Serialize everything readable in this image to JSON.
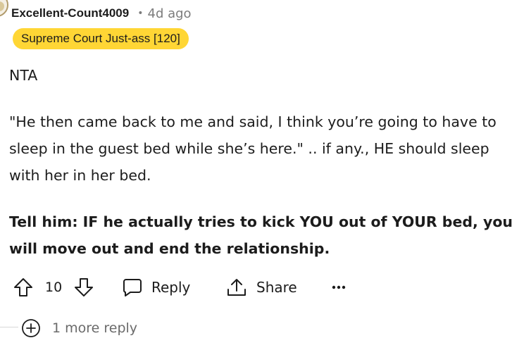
{
  "comment": {
    "username": "Excellent-Count4009",
    "separator": "•",
    "time": "4d ago",
    "flair": "Supreme Court Just-ass [120]",
    "paragraphs": [
      "NTA",
      "\"He then came back to me and said, I think you’re going to have to sleep in the guest bed while she’s here.\" .. if any., HE should sleep with her in her bed.",
      "Tell him: IF he actually tries to kick YOU out of YOUR bed, you will move out and end the relationship."
    ]
  },
  "actions": {
    "score": "10",
    "reply_label": "Reply",
    "share_label": "Share",
    "more_label": "•••"
  },
  "thread": {
    "more_replies_label": "1 more reply"
  },
  "icons": {
    "upvote": "arrow-up-outline-icon",
    "downvote": "arrow-down-outline-icon",
    "reply": "speech-bubble-icon",
    "share": "share-upload-icon",
    "more": "ellipsis-icon",
    "expand": "plus-circle-icon"
  },
  "colors": {
    "flair_background": "#ffd635",
    "text": "#1c1c1c",
    "meta": "#7c7c7c"
  }
}
